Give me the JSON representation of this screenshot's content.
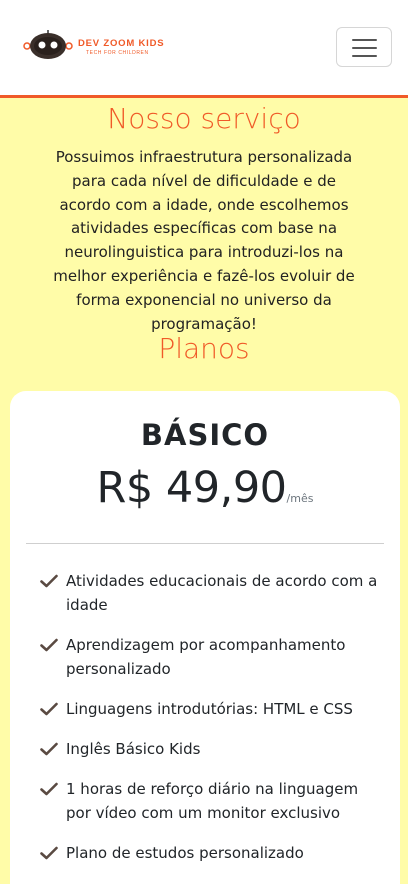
{
  "navbar": {
    "brand_name": "DEV ZOOM KIDS",
    "brand_tagline": "TECH FOR CHILDREN",
    "menu_icon": "hamburger-menu-icon",
    "accent_color": "#f05a28"
  },
  "service": {
    "title": "Nosso serviço",
    "description": "Possuimos infraestrutura personalizada para cada nível de dificuldade e de acordo com a idade, onde escolhemos atividades específicas com base na neurolinguistica para introduzi-los na melhor experiência e fazê-los evoluir de forma exponencial no universo da programação!"
  },
  "plans": {
    "title": "Planos",
    "items": [
      {
        "name": "BÁSICO",
        "price": "R$ 49,90",
        "period": "/mês",
        "features": [
          "Atividades educacionais de acordo com a idade",
          "Aprendizagem por acompanhamento personalizado",
          "Linguagens introdutórias: HTML e CSS",
          "Inglês Básico Kids",
          "1 horas de reforço diário na linguagem por vídeo com um monitor exclusivo",
          "Plano de estudos personalizado"
        ]
      }
    ]
  },
  "colors": {
    "page_background": "#fffca8",
    "title": "#f05a28",
    "check": "#5a4a42"
  }
}
